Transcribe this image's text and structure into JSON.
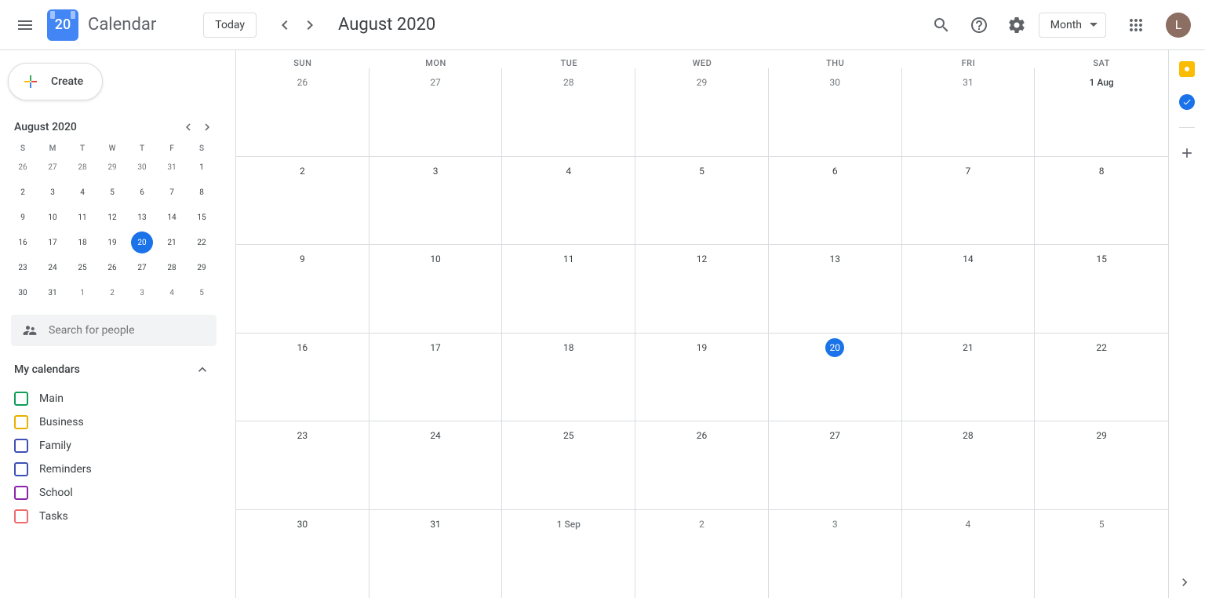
{
  "header": {
    "app_title": "Calendar",
    "logo_day": "20",
    "today_label": "Today",
    "current_period": "August 2020",
    "view_label": "Month",
    "avatar_initial": "L"
  },
  "sidebar": {
    "create_label": "Create",
    "mini_calendar": {
      "title": "August 2020",
      "dow": [
        "S",
        "M",
        "T",
        "W",
        "T",
        "F",
        "S"
      ],
      "weeks": [
        [
          {
            "n": "26",
            "other": true
          },
          {
            "n": "27",
            "other": true
          },
          {
            "n": "28",
            "other": true
          },
          {
            "n": "29",
            "other": true
          },
          {
            "n": "30",
            "other": true
          },
          {
            "n": "31",
            "other": true
          },
          {
            "n": "1"
          }
        ],
        [
          {
            "n": "2"
          },
          {
            "n": "3"
          },
          {
            "n": "4"
          },
          {
            "n": "5"
          },
          {
            "n": "6"
          },
          {
            "n": "7"
          },
          {
            "n": "8"
          }
        ],
        [
          {
            "n": "9"
          },
          {
            "n": "10"
          },
          {
            "n": "11"
          },
          {
            "n": "12"
          },
          {
            "n": "13"
          },
          {
            "n": "14"
          },
          {
            "n": "15"
          }
        ],
        [
          {
            "n": "16"
          },
          {
            "n": "17"
          },
          {
            "n": "18"
          },
          {
            "n": "19"
          },
          {
            "n": "20",
            "today": true
          },
          {
            "n": "21"
          },
          {
            "n": "22"
          }
        ],
        [
          {
            "n": "23"
          },
          {
            "n": "24"
          },
          {
            "n": "25"
          },
          {
            "n": "26"
          },
          {
            "n": "27"
          },
          {
            "n": "28"
          },
          {
            "n": "29"
          }
        ],
        [
          {
            "n": "30"
          },
          {
            "n": "31"
          },
          {
            "n": "1",
            "other": true
          },
          {
            "n": "2",
            "other": true
          },
          {
            "n": "3",
            "other": true
          },
          {
            "n": "4",
            "other": true
          },
          {
            "n": "5",
            "other": true
          }
        ]
      ]
    },
    "search_placeholder": "Search for people",
    "my_calendars_label": "My calendars",
    "calendars": [
      {
        "label": "Main",
        "color": "#0f9d58"
      },
      {
        "label": "Business",
        "color": "#e8b000"
      },
      {
        "label": "Family",
        "color": "#3f51b5"
      },
      {
        "label": "Reminders",
        "color": "#3f51b5"
      },
      {
        "label": "School",
        "color": "#8e24aa"
      },
      {
        "label": "Tasks",
        "color": "#ef6c6c"
      }
    ]
  },
  "grid": {
    "dow": [
      "SUN",
      "MON",
      "TUE",
      "WED",
      "THU",
      "FRI",
      "SAT"
    ],
    "weeks": [
      [
        {
          "n": "26",
          "other": true
        },
        {
          "n": "27",
          "other": true
        },
        {
          "n": "28",
          "other": true
        },
        {
          "n": "29",
          "other": true
        },
        {
          "n": "30",
          "other": true
        },
        {
          "n": "31",
          "other": true
        },
        {
          "n": "1 Aug",
          "firstday": true
        }
      ],
      [
        {
          "n": "2"
        },
        {
          "n": "3"
        },
        {
          "n": "4"
        },
        {
          "n": "5"
        },
        {
          "n": "6"
        },
        {
          "n": "7"
        },
        {
          "n": "8"
        }
      ],
      [
        {
          "n": "9"
        },
        {
          "n": "10"
        },
        {
          "n": "11"
        },
        {
          "n": "12"
        },
        {
          "n": "13"
        },
        {
          "n": "14"
        },
        {
          "n": "15"
        }
      ],
      [
        {
          "n": "16"
        },
        {
          "n": "17"
        },
        {
          "n": "18"
        },
        {
          "n": "19"
        },
        {
          "n": "20",
          "today": true
        },
        {
          "n": "21"
        },
        {
          "n": "22"
        }
      ],
      [
        {
          "n": "23"
        },
        {
          "n": "24"
        },
        {
          "n": "25"
        },
        {
          "n": "26"
        },
        {
          "n": "27"
        },
        {
          "n": "28"
        },
        {
          "n": "29"
        }
      ],
      [
        {
          "n": "30"
        },
        {
          "n": "31"
        },
        {
          "n": "1 Sep",
          "other": true,
          "firstday": true
        },
        {
          "n": "2",
          "other": true
        },
        {
          "n": "3",
          "other": true
        },
        {
          "n": "4",
          "other": true
        },
        {
          "n": "5",
          "other": true
        }
      ]
    ]
  }
}
